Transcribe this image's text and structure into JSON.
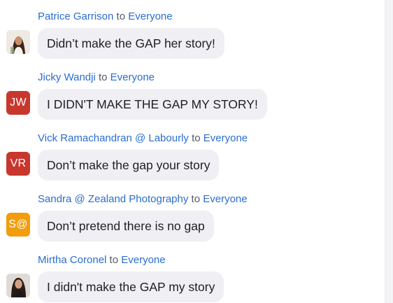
{
  "chat": {
    "messages": [
      {
        "sender": "Patrice Garrison",
        "to_word": "to",
        "recipient": "Everyone",
        "text": "Didn’t make the GAP her story!",
        "avatar": {
          "type": "photo",
          "icon": "woman-photo-avatar"
        }
      },
      {
        "sender": "Jicky Wandji",
        "to_word": "to",
        "recipient": "Everyone",
        "text": "I DIDN'T MAKE THE GAP MY STORY!",
        "avatar": {
          "type": "initials",
          "initials": "JW",
          "color": "#c8372d"
        }
      },
      {
        "sender": "Vick Ramachandran @ Labourly",
        "to_word": "to",
        "recipient": "Everyone",
        "text": "Don’t make the gap your story",
        "avatar": {
          "type": "initials",
          "initials": "VR",
          "color": "#c8372d"
        }
      },
      {
        "sender": "Sandra @ Zealand Photography",
        "to_word": "to",
        "recipient": "Everyone",
        "text": "Don’t pretend there is no gap",
        "avatar": {
          "type": "initials",
          "initials": "S@",
          "color": "#f29d0c"
        }
      },
      {
        "sender": "Mirtha Coronel",
        "to_word": "to",
        "recipient": "Everyone",
        "text": "I didn't make the GAP my story",
        "avatar": {
          "type": "photo",
          "icon": "woman-photo-avatar"
        }
      }
    ]
  },
  "colors": {
    "link_blue": "#2b6ecf",
    "bubble_bg": "#f0f0f4",
    "initials_red": "#c8372d",
    "initials_orange": "#f29d0c"
  }
}
